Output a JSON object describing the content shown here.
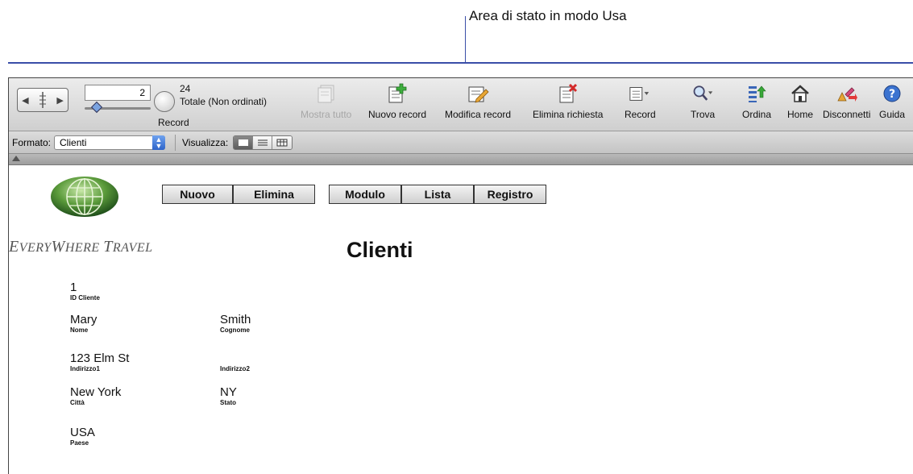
{
  "callout": {
    "text": "Area di stato in modo Usa"
  },
  "status_toolbar": {
    "book_left": "◀",
    "book_right": "▶",
    "record_number": "2",
    "total_count": "24",
    "total_label": "Totale (Non ordinati)",
    "record_label": "Record",
    "buttons": {
      "mostra_tutto": "Mostra tutto",
      "nuovo_record": "Nuovo record",
      "modifica_record": "Modifica record",
      "elimina_richiesta": "Elimina richiesta",
      "record": "Record",
      "trova": "Trova",
      "ordina": "Ordina",
      "home": "Home",
      "disconnetti": "Disconnetti",
      "guida": "Guida"
    }
  },
  "format_bar": {
    "formato_label": "Formato:",
    "formato_value": "Clienti",
    "visualizza_label": "Visualizza:",
    "view_modes": [
      "form",
      "list",
      "table"
    ],
    "active_view": "form"
  },
  "layout": {
    "logo_first": "E",
    "logo_rest1": "VERY",
    "logo_second": "W",
    "logo_rest2": "HERE ",
    "logo_third": "T",
    "logo_rest3": "RAVEL",
    "buttons": {
      "nuovo": "Nuovo",
      "elimina": "Elimina",
      "modulo": "Modulo",
      "lista": "Lista",
      "registro": "Registro"
    },
    "title": "Clienti",
    "fields": {
      "id": {
        "value": "1",
        "label": "ID Cliente"
      },
      "nome": {
        "value": "Mary",
        "label": "Nome"
      },
      "cognome": {
        "value": "Smith",
        "label": "Cognome"
      },
      "indirizzo1": {
        "value": "123 Elm St",
        "label": "Indirizzo1"
      },
      "indirizzo2": {
        "value": "",
        "label": "Indirizzo2"
      },
      "citta": {
        "value": "New York",
        "label": "Città"
      },
      "stato": {
        "value": "NY",
        "label": "Stato"
      },
      "paese": {
        "value": "USA",
        "label": "Paese"
      }
    }
  },
  "colors": {
    "callout_line": "#3a4ea8",
    "slider_thumb": "#7aa3e0",
    "select_stepper": "#2e64c9"
  }
}
